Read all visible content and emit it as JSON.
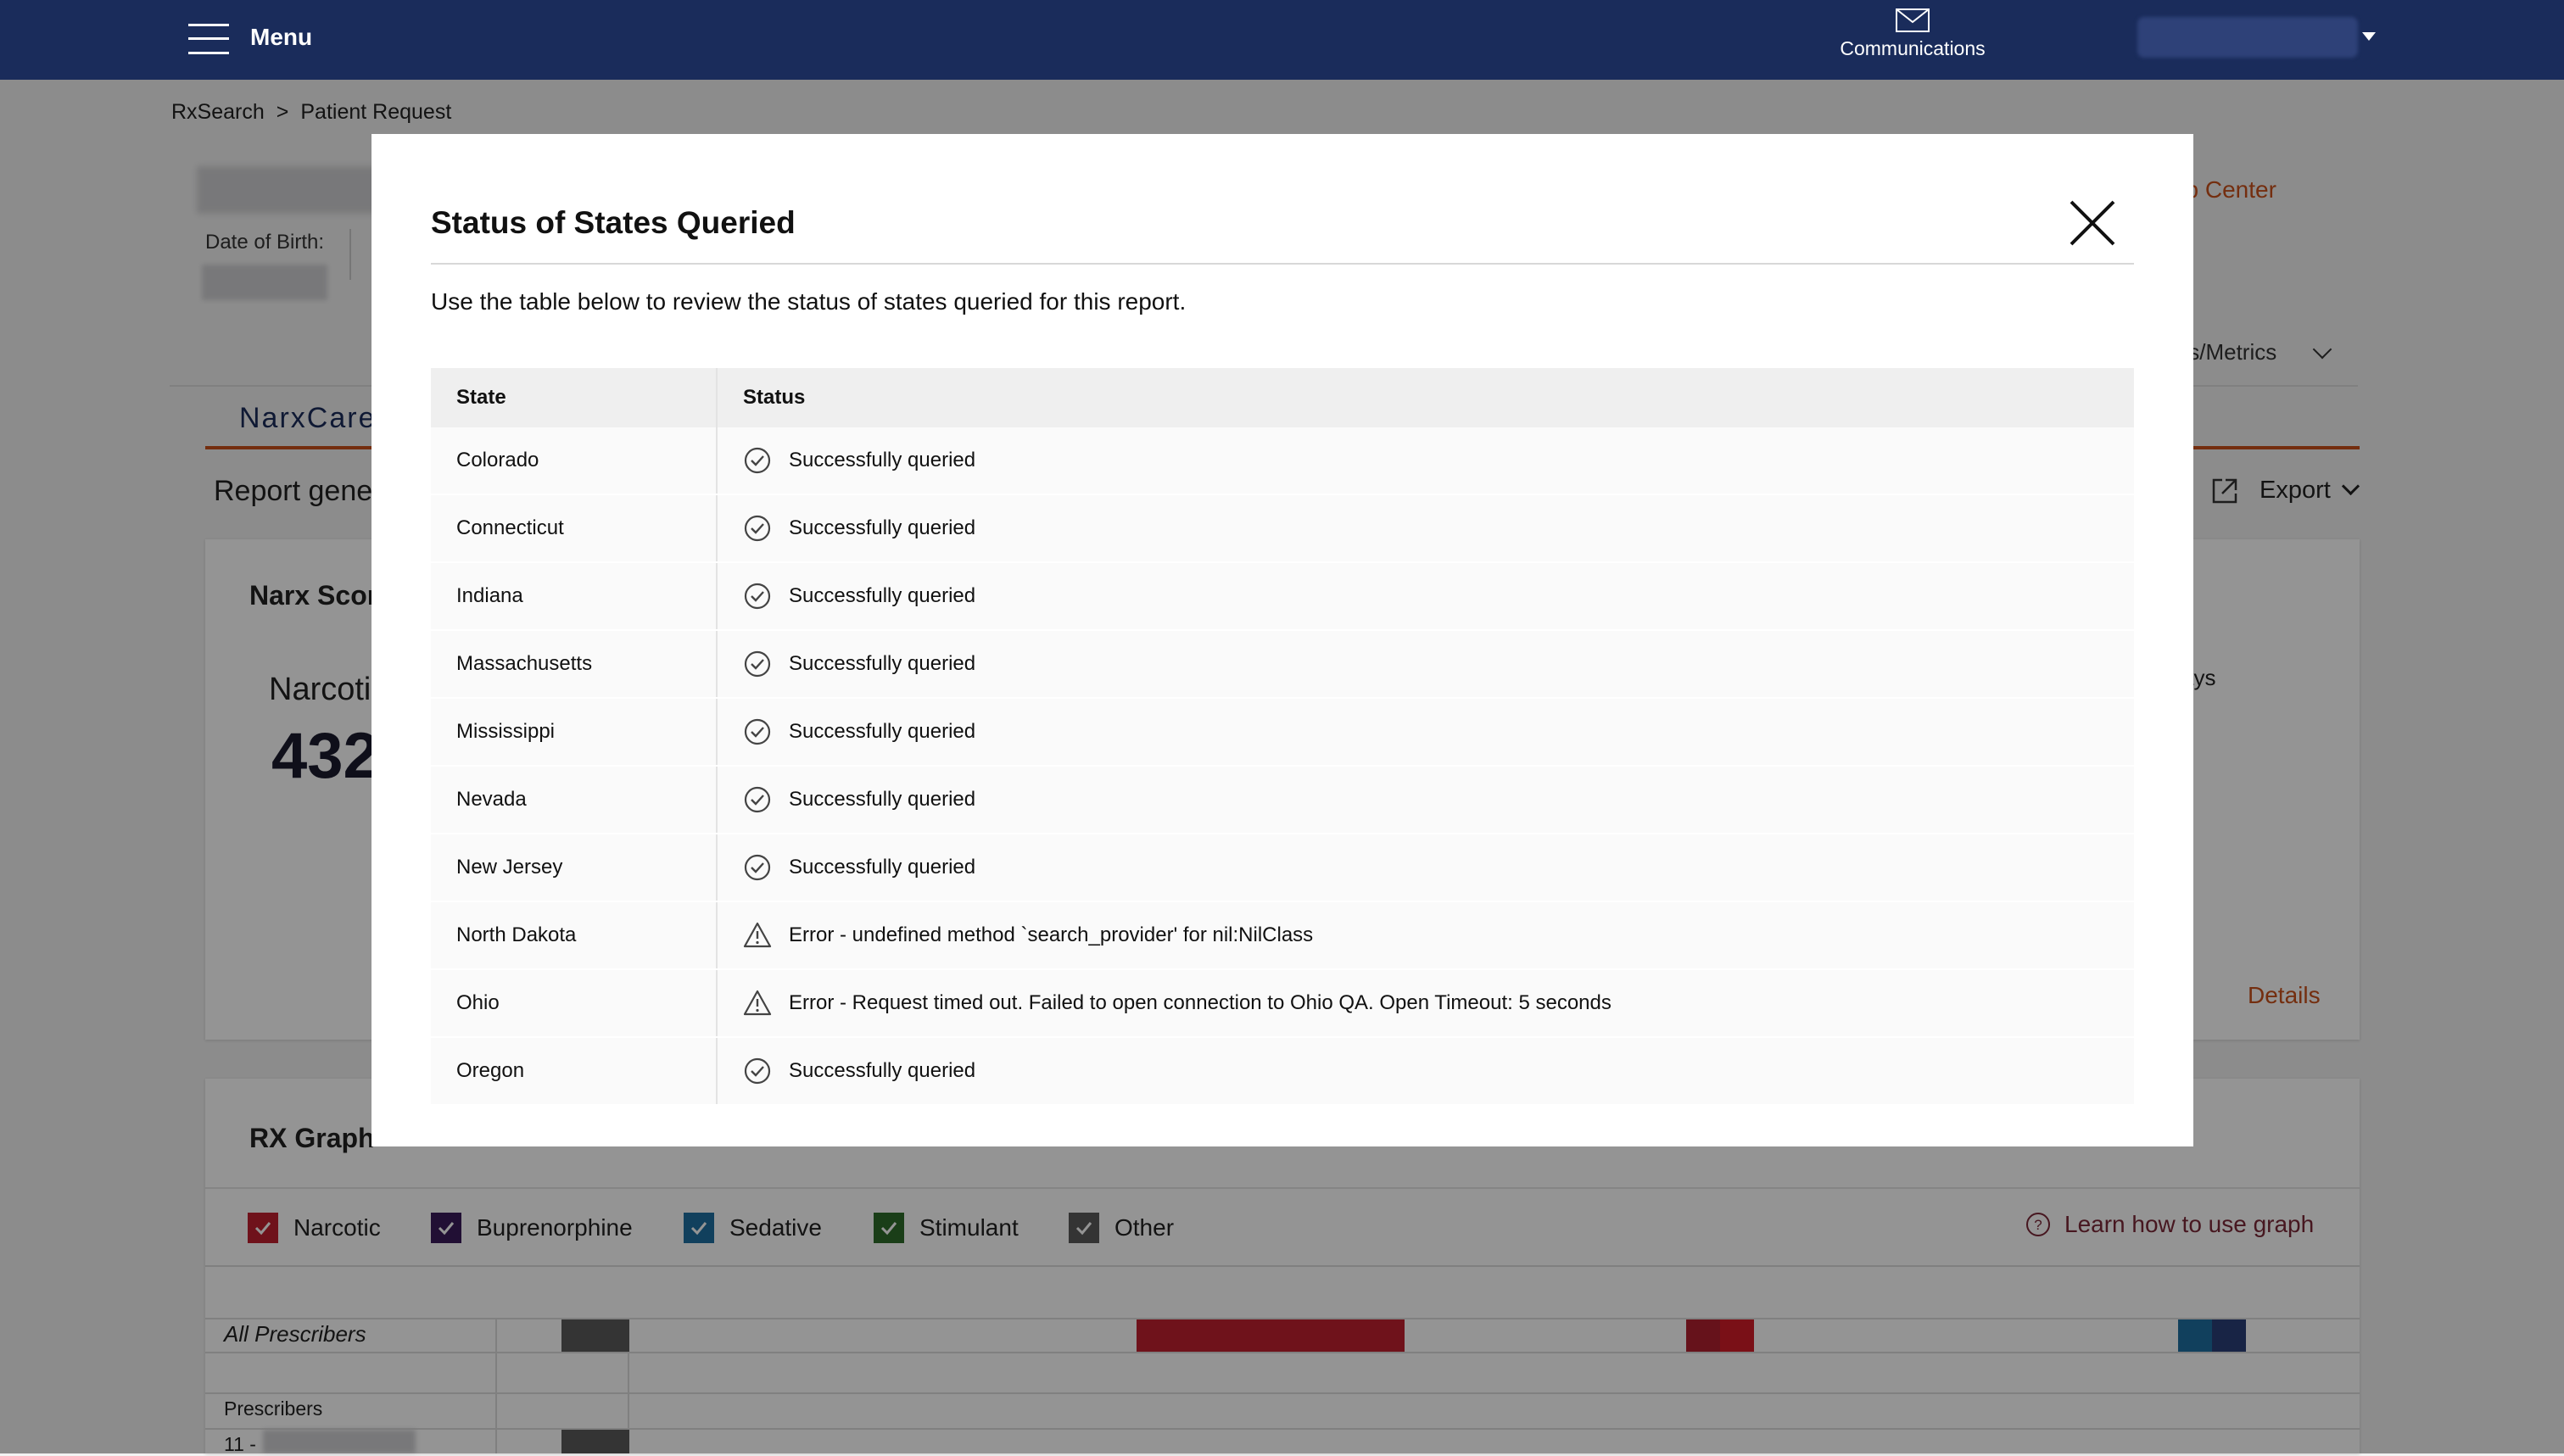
{
  "nav": {
    "menu_label": "Menu",
    "communications_label": "Communications"
  },
  "breadcrumb": {
    "root": "RxSearch",
    "separator": ">",
    "current": "Patient Request"
  },
  "patient": {
    "dob_label": "Date of Birth:"
  },
  "header_links": {
    "help": "dge/Help Center",
    "tools": "ols/Metrics"
  },
  "tabs": {
    "narxcare": "NarxCare"
  },
  "report": {
    "generated_label": "Report gene",
    "export_label": "Export"
  },
  "narx_card": {
    "title": "Narx Scor",
    "narcotic_label": "Narcotic",
    "score": "432",
    "days_label": "ays",
    "details_link": "Details"
  },
  "rx_graph": {
    "title": "RX Graph",
    "legend": [
      {
        "label": "Narcotic",
        "color": "#c0202f"
      },
      {
        "label": "Buprenorphine",
        "color": "#3a1a5a"
      },
      {
        "label": "Sedative",
        "color": "#1e6fa0"
      },
      {
        "label": "Stimulant",
        "color": "#2e6b2a"
      },
      {
        "label": "Other",
        "color": "#5a5a5a"
      }
    ],
    "learn_link": "Learn how to use graph",
    "all_prescribers": "All Prescribers",
    "prescribers_label": "Prescribers",
    "prescriber_row_prefix": "11 -"
  },
  "modal": {
    "title": "Status of States Queried",
    "description": "Use the table below to review the status of states queried for this report.",
    "columns": {
      "state": "State",
      "status": "Status"
    },
    "rows": [
      {
        "state": "Colorado",
        "status": "Successfully queried",
        "type": "success"
      },
      {
        "state": "Connecticut",
        "status": "Successfully queried",
        "type": "success"
      },
      {
        "state": "Indiana",
        "status": "Successfully queried",
        "type": "success"
      },
      {
        "state": "Massachusetts",
        "status": "Successfully queried",
        "type": "success"
      },
      {
        "state": "Mississippi",
        "status": "Successfully queried",
        "type": "success"
      },
      {
        "state": "Nevada",
        "status": "Successfully queried",
        "type": "success"
      },
      {
        "state": "New Jersey",
        "status": "Successfully queried",
        "type": "success"
      },
      {
        "state": "North Dakota",
        "status": "Error - undefined method `search_provider' for nil:NilClass",
        "type": "error"
      },
      {
        "state": "Ohio",
        "status": "Error - Request timed out. Failed to open connection to Ohio QA. Open Timeout: 5 seconds",
        "type": "error"
      },
      {
        "state": "Oregon",
        "status": "Successfully queried",
        "type": "success"
      }
    ]
  },
  "colors": {
    "nav_bg": "#1a2c5b",
    "accent_orange": "#c8501a"
  }
}
